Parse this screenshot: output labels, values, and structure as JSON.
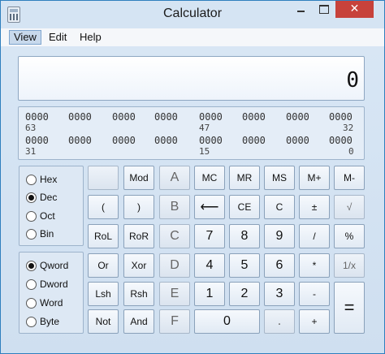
{
  "window": {
    "title": "Calculator",
    "close_symbol": "✕"
  },
  "menu": {
    "view": "View",
    "edit": "Edit",
    "help": "Help"
  },
  "display": {
    "value": "0"
  },
  "bits": {
    "row1": [
      "0000",
      "0000",
      "0000",
      "0000",
      "0000",
      "0000",
      "0000",
      "0000"
    ],
    "row1_labels": [
      "63",
      "47",
      "32"
    ],
    "row2": [
      "0000",
      "0000",
      "0000",
      "0000",
      "0000",
      "0000",
      "0000",
      "0000"
    ],
    "row2_labels": [
      "31",
      "15",
      "0"
    ]
  },
  "base_radios": [
    {
      "label": "Hex",
      "checked": false
    },
    {
      "label": "Dec",
      "checked": true
    },
    {
      "label": "Oct",
      "checked": false
    },
    {
      "label": "Bin",
      "checked": false
    }
  ],
  "word_radios": [
    {
      "label": "Qword",
      "checked": true
    },
    {
      "label": "Dword",
      "checked": false
    },
    {
      "label": "Word",
      "checked": false
    },
    {
      "label": "Byte",
      "checked": false
    }
  ],
  "keys": {
    "blank": "",
    "mod": "Mod",
    "A": "A",
    "MC": "MC",
    "MR": "MR",
    "MS": "MS",
    "Mplus": "M+",
    "Mminus": "M-",
    "lparen": "(",
    "rparen": ")",
    "B": "B",
    "back": "⟵",
    "CE": "CE",
    "C": "C",
    "pm": "±",
    "sqrt": "√",
    "RoL": "RoL",
    "RoR": "RoR",
    "Ckey": "C",
    "k7": "7",
    "k8": "8",
    "k9": "9",
    "div": "/",
    "pct": "%",
    "Or": "Or",
    "Xor": "Xor",
    "D": "D",
    "k4": "4",
    "k5": "5",
    "k6": "6",
    "mul": "*",
    "recip": "1/x",
    "Lsh": "Lsh",
    "Rsh": "Rsh",
    "E": "E",
    "k1": "1",
    "k2": "2",
    "k3": "3",
    "sub": "-",
    "eq": "=",
    "Not": "Not",
    "And": "And",
    "F": "F",
    "k0": "0",
    "dot": ".",
    "add": "+"
  }
}
